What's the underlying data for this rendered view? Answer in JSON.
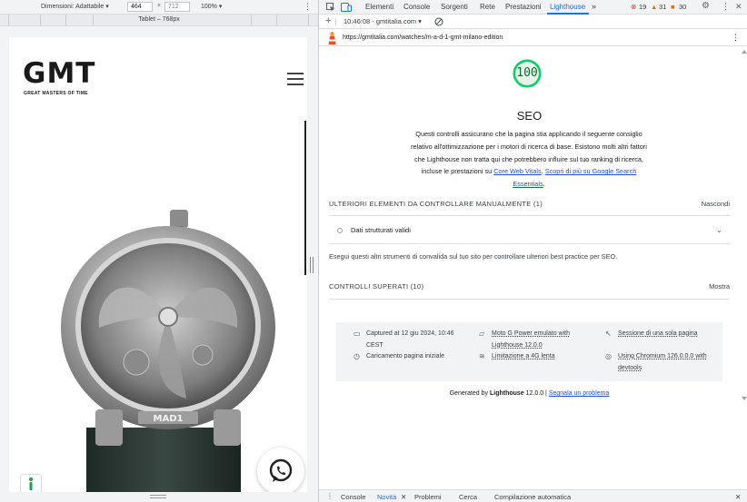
{
  "device_toolbar": {
    "dimensions_label": "Dimensioni: Adattabile ▾",
    "width_value": "464",
    "times": "×",
    "height_value": "712",
    "zoom": "100% ▾",
    "more": "⋮"
  },
  "ruler": {
    "label": "Tablet – 768px"
  },
  "site": {
    "logo_text": "GMT",
    "tagline": "GREAT MASTERS OF TIME",
    "watch_brand": "MAD1"
  },
  "devtools": {
    "tabs": [
      {
        "label": "Elementi"
      },
      {
        "label": "Console"
      },
      {
        "label": "Sorgenti"
      },
      {
        "label": "Rete"
      },
      {
        "label": "Prestazioni"
      },
      {
        "label": "Lighthouse"
      }
    ],
    "overflow": "»",
    "errors": "19",
    "warnings": "31",
    "issues": "30",
    "sub_timestamp": "10:46:08 - gmtitalia.com ▾",
    "url": "https://gmtitalia.com/watches/m-a-d-1-gmt-milano-edition"
  },
  "lighthouse": {
    "score": "100",
    "category": "SEO",
    "description_part1": "Questi controlli assicurano che la pagina stia applicando il seguente consiglio relativo all'ottimizzazione per i motori di ricerca di base. Esistono molti altri fattori che Lighthouse non tratta qui che potrebbero influire sul tuo ranking di ricerca, incluse le prestazioni su ",
    "link_cwv": "Core Web Vitals",
    "sep": ". ",
    "link_more": "Scopri di più su Google Search Essentials",
    "desc_end": ".",
    "manual_header": "ULTERIORI ELEMENTI DA CONTROLLARE MANUALMENTE",
    "manual_count": "(1)",
    "manual_toggle": "Nascondi",
    "audit_label": "Dati strutturati validi",
    "manual_note": "Esegui questi altri strumenti di convalida sul tuo sito per controllare ulteriori best practice per SEO.",
    "passed_header": "CONTROLLI SUPERATI",
    "passed_count": "(10)",
    "passed_toggle": "Mostra",
    "env": {
      "captured_line1": "Captured at 12 giu 2024, 10:46",
      "captured_line2": "CEST",
      "load": "Caricamento pagina iniziale",
      "device_line1": "Moto G Power emulato with",
      "device_line2": "Lighthouse 12.0.0",
      "throttle": "Limitazione a 4G lenta",
      "session": "Sessione di una sola pagina",
      "browser_line1": "Using Chromium 126.0.0.0 with",
      "browser_line2": "devtools"
    },
    "footer_prefix": "Generated by ",
    "footer_brand": "Lighthouse",
    "footer_version": " 12.0.0 | ",
    "footer_link": "Segnala un problema"
  },
  "drawer": {
    "tabs": [
      {
        "label": "Console"
      },
      {
        "label": "Novità"
      },
      {
        "label": "Problemi"
      },
      {
        "label": "Cerca"
      },
      {
        "label": "Compilazione automatica"
      }
    ],
    "close": "✕"
  }
}
